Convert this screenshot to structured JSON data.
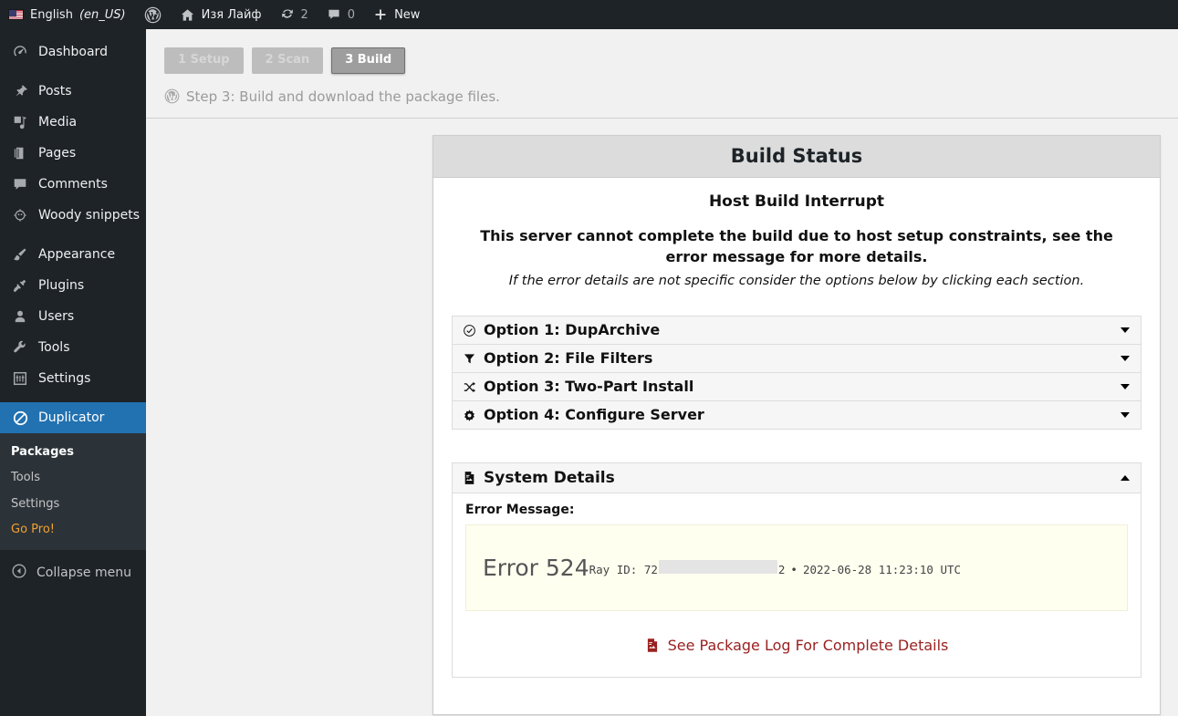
{
  "adminbar": {
    "language": "English",
    "locale": "(en_US)",
    "wp_logo_name": "wordpress-logo-icon",
    "site_name": "Изя Лайф",
    "updates_count": "2",
    "comments_count": "0",
    "new_label": "New"
  },
  "sidebar": {
    "items": [
      {
        "label": "Dashboard",
        "icon": "dashboard-icon"
      },
      {
        "label": "Posts",
        "icon": "pin-icon"
      },
      {
        "label": "Media",
        "icon": "media-icon"
      },
      {
        "label": "Pages",
        "icon": "pages-icon"
      },
      {
        "label": "Comments",
        "icon": "comment-icon"
      },
      {
        "label": "Woody snippets",
        "icon": "woody-snippets-icon"
      },
      {
        "label": "Appearance",
        "icon": "brush-icon"
      },
      {
        "label": "Plugins",
        "icon": "plug-icon"
      },
      {
        "label": "Users",
        "icon": "user-icon"
      },
      {
        "label": "Tools",
        "icon": "wrench-icon"
      },
      {
        "label": "Settings",
        "icon": "settings-icon"
      },
      {
        "label": "Duplicator",
        "icon": "duplicator-icon"
      }
    ],
    "submenu": [
      {
        "label": "Packages",
        "state": "current"
      },
      {
        "label": "Tools",
        "state": "normal"
      },
      {
        "label": "Settings",
        "state": "normal"
      },
      {
        "label": "Go Pro!",
        "state": "pro"
      }
    ],
    "collapse_label": "Collapse menu",
    "active_color": "#2271b1",
    "pro_color": "#f0a132"
  },
  "steps": {
    "items": [
      {
        "label": "1 Setup",
        "state": "done"
      },
      {
        "label": "2 Scan",
        "state": "done"
      },
      {
        "label": "3 Build",
        "state": "active"
      }
    ],
    "description": "Step 3: Build and download the package files."
  },
  "panel": {
    "title": "Build Status",
    "status_title": "Host Build Interrupt",
    "message": "This server cannot complete the build due to host setup constraints, see the error message for more details.",
    "hint": "If the error details are not specific consider the options below by clicking each section."
  },
  "options": [
    {
      "label": "Option 1: DupArchive",
      "icon": "check-circle-icon",
      "caret": "down"
    },
    {
      "label": "Option 2: File Filters",
      "icon": "filter-icon",
      "caret": "down"
    },
    {
      "label": "Option 3: Two-Part Install",
      "icon": "shuffle-icon",
      "caret": "down"
    },
    {
      "label": "Option 4: Configure Server",
      "icon": "gear-icon",
      "caret": "down"
    }
  ],
  "system_details": {
    "title": "System Details",
    "icon": "file-log-icon",
    "caret": "up",
    "error_label": "Error Message:",
    "error_code": "Error 524",
    "ray_id_prefix": "Ray ID: 72",
    "ray_id_suffix": "2",
    "separator": "•",
    "timestamp": "2022-06-28 11:23:10 UTC",
    "log_link": "See Package Log For Complete Details",
    "log_link_color": "#9a2121"
  }
}
